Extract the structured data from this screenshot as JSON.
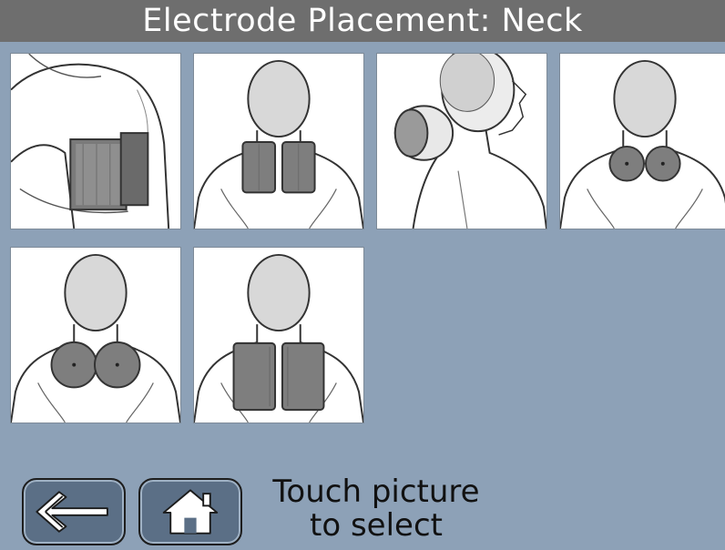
{
  "header": {
    "title": "Electrode Placement: Neck"
  },
  "placements": [
    {
      "icon": "side-view-pad-icon"
    },
    {
      "icon": "rectangular-pads-upper-back-icon"
    },
    {
      "icon": "side-profile-round-electrode-icon"
    },
    {
      "icon": "round-electrodes-neck-icon"
    },
    {
      "icon": "round-electrodes-shoulders-icon"
    },
    {
      "icon": "rectangular-pads-large-icon"
    }
  ],
  "footer": {
    "back_icon": "back-arrow-icon",
    "home_icon": "home-icon",
    "hint_line1": "Touch picture",
    "hint_line2": "to select"
  },
  "colors": {
    "background": "#8da1b7",
    "title_bar": "#6e6e6e",
    "button": "#5b6f86"
  }
}
